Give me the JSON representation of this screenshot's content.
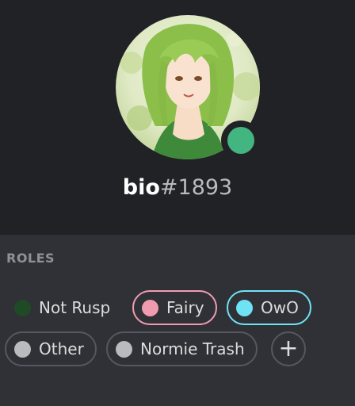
{
  "profile": {
    "username": "bio",
    "discriminator": "#1893",
    "status_color": "#43b581",
    "avatar_description": "anime character with green hair"
  },
  "roles_section": {
    "title": "ROLES",
    "roles": [
      {
        "name": "Not Rusp",
        "color": "#1f4a26"
      },
      {
        "name": "Fairy",
        "color": "#f09bb0"
      },
      {
        "name": "OwO",
        "color": "#6fe3f5"
      },
      {
        "name": "Other",
        "color": "#b9bbbe"
      },
      {
        "name": "Normie Trash",
        "color": "#b9bbbe"
      }
    ],
    "add_icon": "plus-icon"
  }
}
